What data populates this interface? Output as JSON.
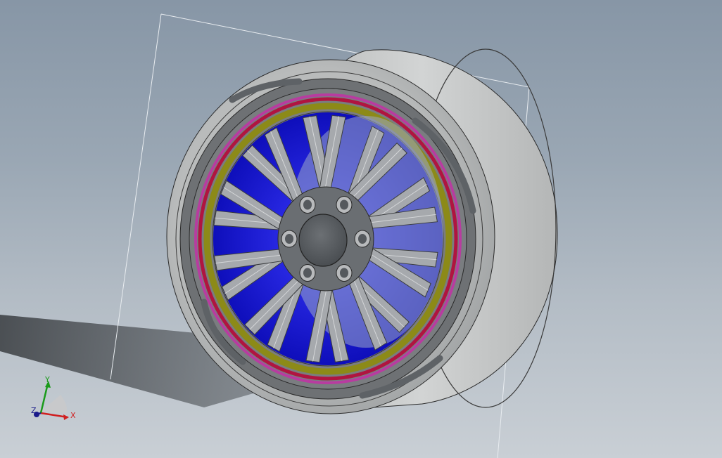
{
  "viewport": {
    "background_top": "#8796a6",
    "background_bottom": "#c9cfd5"
  },
  "model": {
    "tire_color": "#c4c6c6",
    "rim_color": "#6e7174",
    "inner_barrel_color": "#1414d8",
    "accent_red": "#b01440",
    "accent_yellow": "#8c8a18",
    "accent_magenta": "#b83ca0",
    "spoke_color": "#a6a9ad",
    "hub_color": "#585c60",
    "lug_nut_count": "6",
    "spoke_pair_count": "10"
  },
  "triad": {
    "x_label": "X",
    "y_label": "Y",
    "z_label": "Z",
    "x_color": "#d02020",
    "y_color": "#1a9a1a",
    "z_color": "#1a1a8a"
  }
}
